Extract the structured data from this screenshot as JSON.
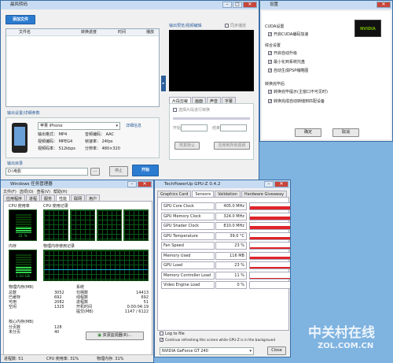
{
  "converter": {
    "title": "晨风转码",
    "add_file": "添加文件",
    "cols": [
      "文件名",
      "转换进度",
      "时间",
      "播放"
    ],
    "output_settings_label": "输出设置/详细参数",
    "device": "苹果 iPhone",
    "details_link": "详细信息",
    "params": [
      [
        "输出格式：",
        "MP4",
        "音频编码：",
        "AAC"
      ],
      [
        "视频编码：",
        "MPEG4",
        "帧速率：",
        "24fps"
      ],
      [
        "视频码率：",
        "512kbps",
        "分辨率：",
        "480×320"
      ]
    ],
    "output_dir_label": "输出目录",
    "output_dir": "D:\\电影",
    "browse": "...",
    "open_btn": "",
    "stop_btn": "停止",
    "start_btn": "开始",
    "preview_label": "输出预览/视频编辑",
    "sync_play": "同步播放",
    "preview_tabs": [
      "片段剪裁",
      "画面",
      "声音",
      "字幕"
    ],
    "clip_checkbox": "选择片段进行转换",
    "start_label": "开始",
    "end_label": "结束",
    "reset_btn": "恢复默认",
    "apply_btn": "应用到所有视频"
  },
  "settings": {
    "title": "设置",
    "cuda_group": "CUDA设置",
    "cuda_enable": "开启CUDA编码加速",
    "general_group": "综合设置",
    "general_items": [
      "开启自动升级",
      "最小化到系统托盘",
      "自动生成PSP缩略图"
    ],
    "after_group": "转换完毕后",
    "after_items": [
      "转换完毕提示(主窗口不可见时)",
      "转换完成自动转储到匹配设备"
    ],
    "ok": "确定",
    "cancel": "取消",
    "nvidia": "NVIDIA"
  },
  "taskmgr": {
    "title": "Windows 任务管理器",
    "menu": [
      "文件(F)",
      "选项(O)",
      "查看(V)",
      "帮助(H)"
    ],
    "tabs": [
      "应用程序",
      "进程",
      "服务",
      "性能",
      "联网",
      "用户"
    ],
    "cpu_usage": "CPU 使用率",
    "cpu_percent": "31 %",
    "cpu_history": "CPU 使用记录",
    "mem": "内存",
    "mem_value": "1.10 GB",
    "mem_history": "物理内存使用记录",
    "phys_header": "物理内存(MB)",
    "phys": [
      [
        "总数",
        "3052"
      ],
      [
        "已缓存",
        "692"
      ],
      [
        "可用",
        "2082"
      ],
      [
        "空闲",
        "1325"
      ]
    ],
    "sys_header": "系统",
    "sys": [
      [
        "句柄数",
        "14413"
      ],
      [
        "线程数",
        "692"
      ],
      [
        "进程数",
        "51"
      ],
      [
        "开机时间",
        "0:00:04:19"
      ],
      [
        "提交(MB)",
        "1147 / 6122"
      ]
    ],
    "kernel_header": "核心内存(MB)",
    "kernel": [
      [
        "分页数",
        "128"
      ],
      [
        "未分页",
        "40"
      ]
    ],
    "resmon_btn": "资源监视器(R)...",
    "status": [
      "进程数: 51",
      "CPU 使用率: 31%",
      "物理内存: 31%"
    ]
  },
  "gpuz": {
    "title": "TechPowerUp GPU-Z 0.4.2",
    "tabs": [
      "Graphics Card",
      "Sensors",
      "Validation",
      "Hardware Giveaway"
    ],
    "sensors": [
      {
        "name": "GPU Core Clock",
        "value": "405.0 MHz",
        "level": 0.55
      },
      {
        "name": "GPU Memory Clock",
        "value": "324.0 MHz",
        "level": 0.45
      },
      {
        "name": "GPU Shader Clock",
        "value": "810.0 MHz",
        "level": 0.5
      },
      {
        "name": "GPU Temperature",
        "value": "39.0 °C",
        "level": 0.35
      },
      {
        "name": "Fan Speed",
        "value": "23 %",
        "level": 0.25
      },
      {
        "name": "Memory Used",
        "value": "116 MB",
        "level": 0.3
      },
      {
        "name": "GPU Load",
        "value": "23 %",
        "level": 0.2
      },
      {
        "name": "Memory Controller Load",
        "value": "11 %",
        "level": 0.12
      },
      {
        "name": "Video Engine Load",
        "value": "0 %",
        "level": 0.0
      }
    ],
    "log_file": "Log to file",
    "continue_refresh": "Continue refreshing this screen while GPU-Z is in the background",
    "card": "NVIDIA GeForce GT 240",
    "close": "Close"
  },
  "watermark": "中关村在线",
  "watermark_url": "ZOL.COM.CN"
}
